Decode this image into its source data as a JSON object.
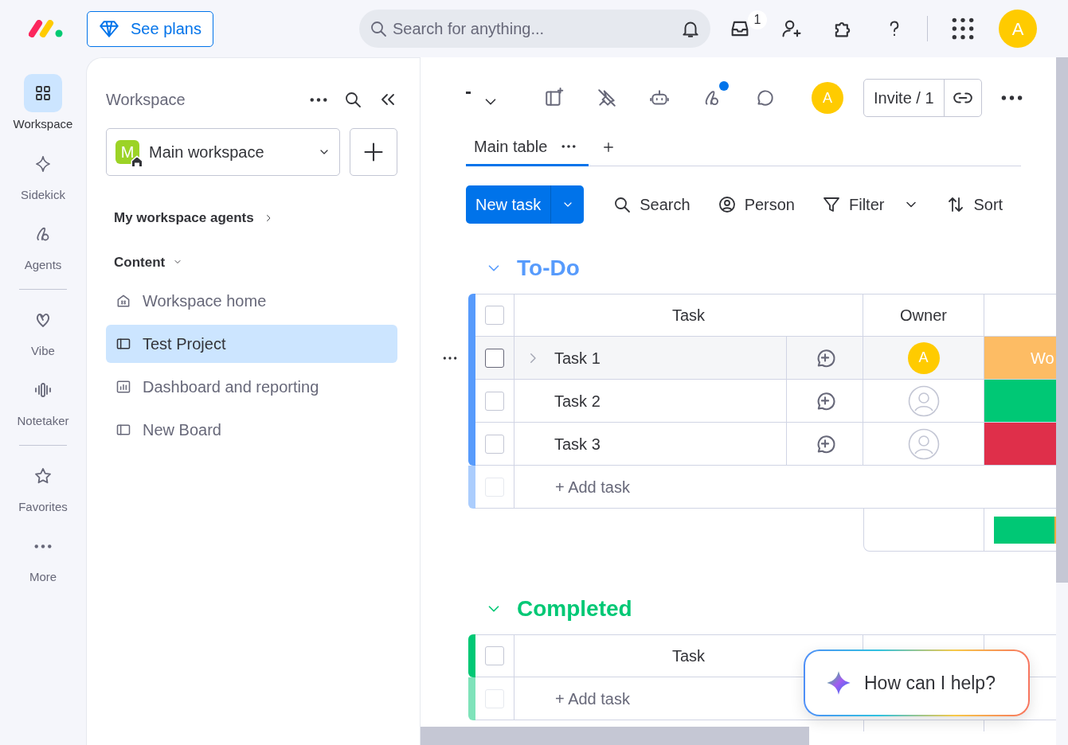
{
  "topbar": {
    "see_plans": "See plans",
    "search_placeholder": "Search for anything...",
    "inbox_badge": "1",
    "avatar": "A"
  },
  "rail": [
    {
      "kind": "grid",
      "label": "Workspace",
      "selected": true
    },
    {
      "kind": "sparkle",
      "label": "Sidekick",
      "selected": false
    },
    {
      "kind": "agent",
      "label": "Agents",
      "selected": false
    },
    {
      "kind": "divider"
    },
    {
      "kind": "heart",
      "label": "Vibe",
      "selected": false
    },
    {
      "kind": "wave",
      "label": "Notetaker",
      "selected": false
    },
    {
      "kind": "divider"
    },
    {
      "kind": "star",
      "label": "Favorites",
      "selected": false
    },
    {
      "kind": "dots",
      "label": "More",
      "selected": false
    }
  ],
  "sidebar": {
    "title": "Workspace",
    "workspace": {
      "initial": "M",
      "name": "Main workspace"
    },
    "agents_link": "My workspace agents",
    "section": "Content",
    "section_expanded": true,
    "items": [
      {
        "kind": "home",
        "label": "Workspace home",
        "selected": false
      },
      {
        "kind": "board",
        "label": "Test Project",
        "selected": true
      },
      {
        "kind": "chart",
        "label": "Dashboard and reporting",
        "selected": false
      },
      {
        "kind": "board",
        "label": "New Board",
        "selected": false
      }
    ]
  },
  "board": {
    "avatar": "A",
    "invite": "Invite / 1",
    "tabs": [
      {
        "label": "Main table",
        "selected": true
      }
    ],
    "new_task": "New task",
    "toolbar": [
      {
        "kind": "search",
        "label": "Search",
        "dropdown": false
      },
      {
        "kind": "person",
        "label": "Person",
        "dropdown": false
      },
      {
        "kind": "filter",
        "label": "Filter",
        "dropdown": true
      },
      {
        "kind": "sort",
        "label": "Sort",
        "dropdown": false
      }
    ],
    "groups": [
      {
        "title": "To-Do",
        "color": "#579bfc",
        "expanded": true,
        "columns": [
          "Task",
          "Owner"
        ],
        "select_all": {
          "checked": false
        },
        "summary": true,
        "add_row": {
          "label": "+ Add task",
          "checked": false
        },
        "rows": [
          {
            "task": "Task 1",
            "owner": "A",
            "status": "Wo",
            "color": "#fdbc64",
            "hovered": true,
            "checked": false
          },
          {
            "task": "Task 2",
            "color": "#00c875",
            "hovered": false,
            "checked": false
          },
          {
            "task": "Task 3",
            "color": "#df2f4a",
            "hovered": false,
            "checked": false
          }
        ]
      },
      {
        "title": "Completed",
        "color": "#00c875",
        "expanded": true,
        "columns": [
          "Task"
        ],
        "select_all": {
          "checked": false
        },
        "add_row": {
          "label": "+ Add task",
          "checked": false
        }
      }
    ]
  },
  "assistant": {
    "prompt": "How can I help?"
  }
}
